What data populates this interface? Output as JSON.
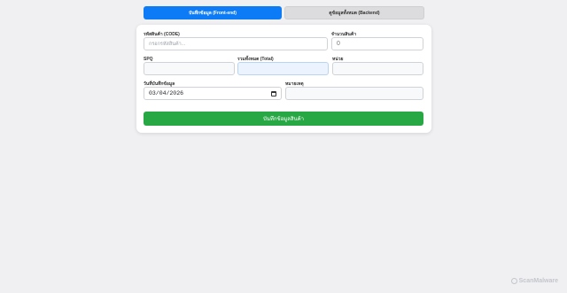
{
  "tabs": [
    {
      "label": "บันทึกข้อมูล (Front-end)",
      "active": true
    },
    {
      "label": "ดูข้อมูลทั้งหมด (Backend)",
      "active": false
    }
  ],
  "form": {
    "code": {
      "label": "รหัสสินค้า (CODE)",
      "placeholder": "กรอกรหัสสินค้า..."
    },
    "quantity": {
      "label": "จำนวนสินค้า",
      "value": "0"
    },
    "spq": {
      "label": "SPQ",
      "value": ""
    },
    "total": {
      "label": "รวมทั้งหมด (Total)",
      "value": ""
    },
    "unit": {
      "label": "หน่วย",
      "value": ""
    },
    "date": {
      "label": "วันที่บันทึกข้อมูล",
      "value": "03/04/2026"
    },
    "note": {
      "label": "หมายเหตุ",
      "value": ""
    },
    "submit_label": "บันทึกข้อมูลสินค้า"
  },
  "watermark": "ScanMalware",
  "colors": {
    "primary": "#0d7bf5",
    "success": "#28a745",
    "background": "#f0f0f2"
  }
}
